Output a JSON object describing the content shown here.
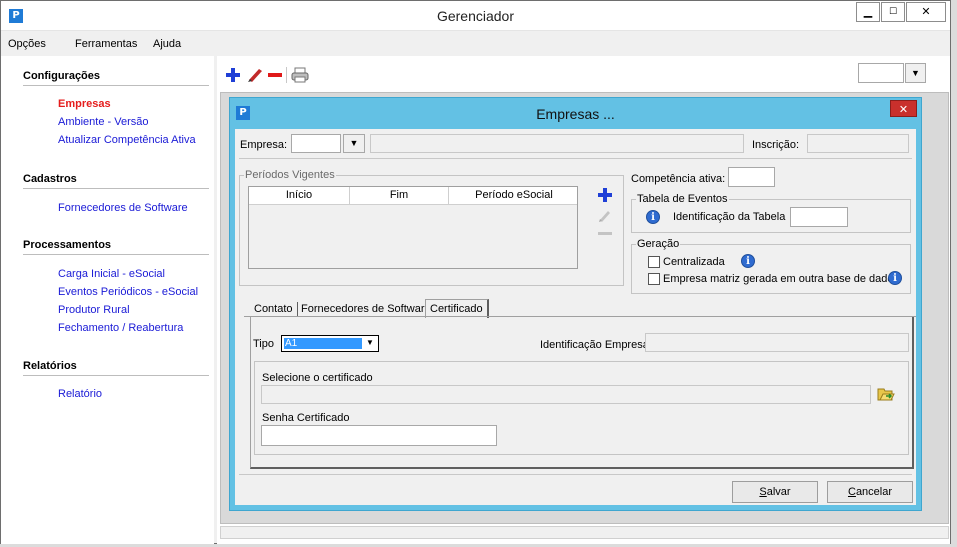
{
  "window": {
    "title": "Gerenciador",
    "icon": "app-logo-icon"
  },
  "menu": {
    "items": [
      "Opções",
      "Ferramentas",
      "Ajuda"
    ]
  },
  "sidebar": {
    "sections": [
      {
        "title": "Configurações",
        "items": [
          "Empresas",
          "Ambiente - Versão",
          "Atualizar Competência Ativa"
        ]
      },
      {
        "title": "Cadastros",
        "items": [
          "Fornecedores de Software"
        ]
      },
      {
        "title": "Processamentos",
        "items": [
          "Carga Inicial - eSocial",
          "Eventos Periódicos - eSocial",
          "Produtor Rural",
          "Fechamento / Reabertura"
        ]
      },
      {
        "title": "Relatórios",
        "items": [
          "Relatório"
        ]
      }
    ],
    "active_item": "Empresas"
  },
  "toolbar": {
    "icons": [
      "add-icon",
      "edit-icon",
      "remove-icon",
      "print-icon"
    ]
  },
  "dialog": {
    "title": "Empresas ...",
    "empresa_label": "Empresa:",
    "empresa_value": "",
    "empresa_name": "",
    "inscricao_label": "Inscrição:",
    "inscricao_value": "",
    "periodos": {
      "title": "Períodos Vigentes",
      "columns": [
        "Início",
        "Fim",
        "Período eSocial"
      ],
      "rows": []
    },
    "competencia_label": "Competência ativa:",
    "competencia_value": "",
    "tabela_eventos": {
      "title": "Tabela de Eventos",
      "id_label": "Identificação da Tabela",
      "id_value": ""
    },
    "geracao": {
      "title": "Geração",
      "centralizada_label": "Centralizada",
      "centralizada_checked": false,
      "matriz_label": "Empresa matriz gerada em outra base de dados",
      "matriz_checked": false
    },
    "tabs": [
      "Contato",
      "Fornecedores de Software",
      "Certificado"
    ],
    "active_tab": "Certificado",
    "certificado": {
      "tipo_label": "Tipo",
      "tipo_value": "A1",
      "id_empresa_label": "Identificação Empresa",
      "id_empresa_value": "",
      "selecione_label": "Selecione o certificado",
      "selecione_value": "",
      "senha_label": "Senha Certificado",
      "senha_value": ""
    },
    "buttons": {
      "salvar": "alvar",
      "salvar_accel": "S",
      "cancelar": "ancelar",
      "cancelar_accel": "C"
    }
  },
  "colors": {
    "accent": "#63c1e4",
    "active_link": "#e51c1c",
    "link": "#1a1ad6"
  }
}
